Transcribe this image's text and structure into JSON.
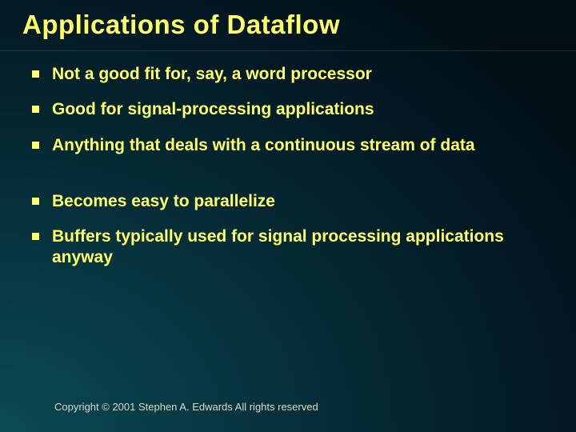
{
  "title": "Applications of Dataflow",
  "bullets": [
    "Not a good fit for, say, a word processor",
    "Good for signal-processing applications",
    "Anything that deals with a continuous stream of data",
    "Becomes easy to parallelize",
    "Buffers typically used for signal processing applications anyway"
  ],
  "footer": "Copyright © 2001 Stephen A. Edwards  All rights reserved"
}
